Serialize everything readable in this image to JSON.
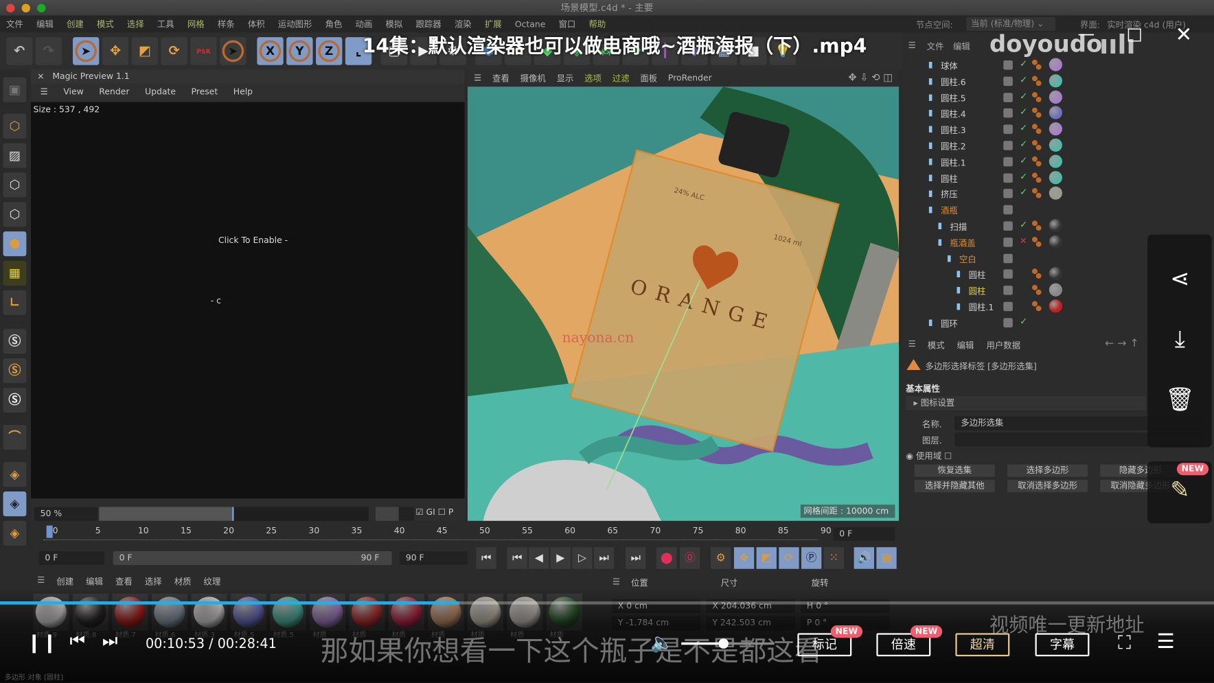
{
  "window": {
    "title": "场景模型.c4d * - 主要",
    "traffic_lights": [
      "#e0443e",
      "#dea123",
      "#1aab29"
    ]
  },
  "menu": [
    "文件",
    "编辑",
    "创建",
    "模式",
    "选择",
    "工具",
    "网格",
    "样条",
    "体积",
    "运动图形",
    "角色",
    "动画",
    "模拟",
    "跟踪器",
    "渲染",
    "扩展",
    "Octane",
    "窗口",
    "帮助"
  ],
  "menu_highlight": [
    "创建",
    "模式",
    "选择",
    "网格",
    "扩展",
    "帮助"
  ],
  "node_space": {
    "label": "节点空间:",
    "value": "当前 (标准/物理)"
  },
  "layout": {
    "label": "界面:",
    "value": "实时渲染 c4d (用户)"
  },
  "toolbar": {
    "x": "X",
    "y": "Y",
    "z": "Z",
    "psr": "PSR"
  },
  "video": {
    "title": "14集：默认渲染器也可以做电商哦~酒瓶海报（下）.mp4",
    "watermark": "doyoudo",
    "site_watermark": "nayona.cn",
    "update_note": "视频唯一更新地址",
    "subtitle": "那如果你想看一下这个瓶子是不是都这看",
    "time": "00:10:53 / 00:28:41",
    "progress": 0.378,
    "buttons": {
      "mark": "标记",
      "speed": "倍速",
      "quality": "超清",
      "subtitles": "字幕"
    },
    "new_badge": "NEW",
    "accent": "#23ade5"
  },
  "magic_preview": {
    "title": "Magic Preview 1.1",
    "menu": [
      "View",
      "Render",
      "Update",
      "Preset",
      "Help"
    ],
    "size": "Size : 537 , 492",
    "click": "Click To Enable -",
    "zoom": "50 %",
    "gi_label": "GI",
    "gi_checked": true,
    "p_label": "P",
    "p_checked": false
  },
  "viewport": {
    "menu": [
      "查看",
      "摄像机",
      "显示",
      "选项",
      "过滤",
      "面板",
      "ProRender"
    ],
    "menu_highlight": [
      "选项",
      "过滤"
    ],
    "grid_spacing": "网格间距 : 10000 cm",
    "bottle_text": "ORANGE",
    "alc": "24% ALC",
    "volume": "1024 ml"
  },
  "object_manager": {
    "menu": [
      "文件",
      "编辑"
    ],
    "objects": [
      {
        "name": "球体",
        "level": 0,
        "mat": "#a77fc9",
        "check": true
      },
      {
        "name": "圆柱.6",
        "level": 0,
        "mat": "#4fb8a6",
        "check": true
      },
      {
        "name": "圆柱.5",
        "level": 0,
        "mat": "#a77fc9",
        "check": true
      },
      {
        "name": "圆柱.4",
        "level": 0,
        "mat": "#7070c0",
        "check": true
      },
      {
        "name": "圆柱.3",
        "level": 0,
        "mat": "#a77fc9",
        "check": true
      },
      {
        "name": "圆柱.2",
        "level": 0,
        "mat": "#4fb8a6",
        "check": true
      },
      {
        "name": "圆柱.1",
        "level": 0,
        "mat": "#4fb8a6",
        "check": true
      },
      {
        "name": "圆柱",
        "level": 0,
        "mat": "#4fb8a6",
        "check": true
      },
      {
        "name": "挤压",
        "level": 0,
        "mat": "#9a9a90",
        "check": true
      },
      {
        "name": "酒瓶",
        "level": 0,
        "color": "#d88a3a",
        "check": false
      },
      {
        "name": "扫描",
        "level": 1,
        "mat": "#333333",
        "check": true
      },
      {
        "name": "瓶酒盖",
        "level": 1,
        "color": "#d88a3a",
        "mat": "#333333",
        "check": false,
        "cross": true
      },
      {
        "name": "空白",
        "level": 2,
        "color": "#d88a3a",
        "check": false
      },
      {
        "name": "圆柱",
        "level": 3,
        "mat": "#333333",
        "check": false
      },
      {
        "name": "圆柱",
        "level": 3,
        "color": "#e8d040",
        "mat": "#888888",
        "check": false
      },
      {
        "name": "圆柱.1",
        "level": 3,
        "mat": "#c02020",
        "check": false
      },
      {
        "name": "圆环",
        "level": 0,
        "check": true
      }
    ]
  },
  "attributes": {
    "menu": [
      "模式",
      "编辑",
      "用户数据"
    ],
    "tag_title": "多边形选择标签 [多边形选集]",
    "section": "基本属性",
    "group": "图标设置",
    "name_label": "名称.",
    "name_value": "多边形选集",
    "layer_label": "图层.",
    "use_field": "使用域",
    "buttons": [
      "恢复选集",
      "选择多边形",
      "隐藏多边形",
      "选择并隐藏其他",
      "取消选择多边形",
      "取消隐藏多边形"
    ]
  },
  "timeline": {
    "ticks": [
      "0",
      "5",
      "10",
      "15",
      "20",
      "25",
      "30",
      "35",
      "40",
      "45",
      "50",
      "55",
      "60",
      "65",
      "70",
      "75",
      "80",
      "85",
      "90"
    ],
    "current": "0 F",
    "start": "0 F",
    "range_start": "0 F",
    "range_end": "90 F",
    "end": "90 F"
  },
  "materials": {
    "menu": [
      "创建",
      "编辑",
      "查看",
      "选择",
      "材质",
      "纹理"
    ],
    "swatches": [
      {
        "name": "材质.9",
        "color": "#d8d8d8"
      },
      {
        "name": "材质.8",
        "color": "#2a2a2a"
      },
      {
        "name": "材质.7",
        "color": "#b82020"
      },
      {
        "name": "材质.6",
        "color": "#8a9aa8"
      },
      {
        "name": "材质.3",
        "color": "#dcdcdc"
      },
      {
        "name": "材质.5",
        "color": "#6a70c0"
      },
      {
        "name": "材质.5",
        "color": "#4fb8a6"
      },
      {
        "name": "材质",
        "color": "#a77fc9"
      },
      {
        "name": "材质",
        "color": "#b83030"
      },
      {
        "name": "材质",
        "color": "#c02848"
      },
      {
        "name": "材质",
        "color": "#c8906a"
      },
      {
        "name": "材质",
        "color": "#c8c0b0"
      },
      {
        "name": "材质",
        "color": "#c8c0b8"
      },
      {
        "name": "材质",
        "color": "#2a5a2a"
      }
    ]
  },
  "coordinates": {
    "headers": [
      "位置",
      "尺寸",
      "旋转"
    ],
    "rows": [
      [
        "X",
        "0 cm",
        "X",
        "204.036 cm",
        "H",
        "0 °"
      ],
      [
        "Y",
        "-1.784 cm",
        "Y",
        "242.503 cm",
        "P",
        "0 °"
      ]
    ]
  },
  "status": "多边形 对象 [圆柱]"
}
